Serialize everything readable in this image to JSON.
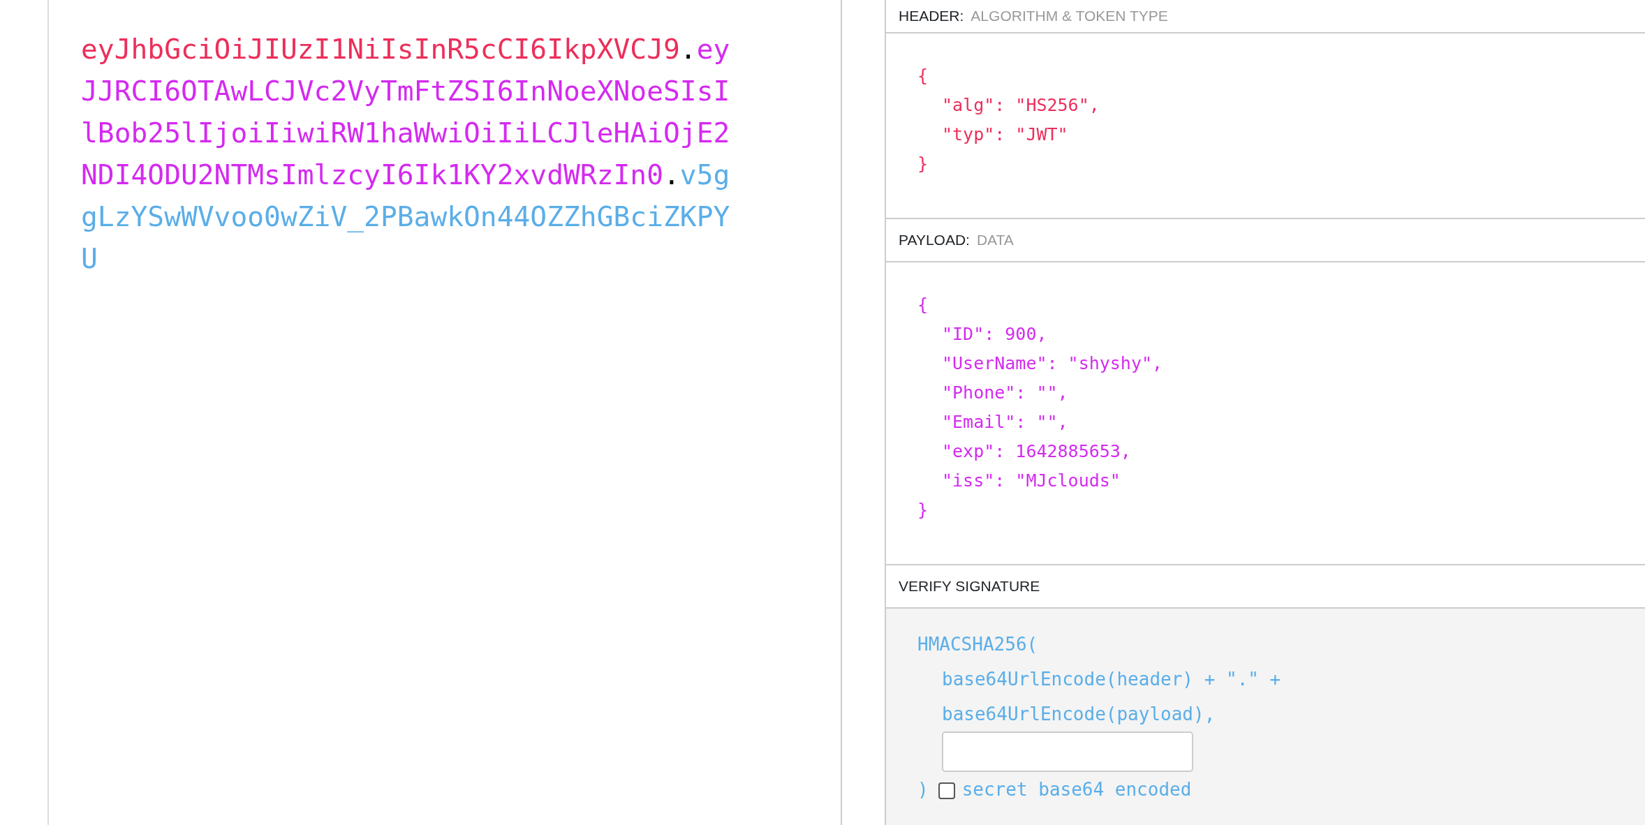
{
  "token": {
    "parts": [
      {
        "kind": "header",
        "text": "eyJhbGciOiJIUzI1NiIsInR5cCI6IkpXVCJ9"
      },
      {
        "kind": "dot",
        "text": "."
      },
      {
        "kind": "payload",
        "text": "eyJJRCI6OTAwLCJVc2VyTmFtZSI6InNoeXNoeSIsIlBob25lIjoiIiwiRW1haWwiOiIiLCJleHAiOjE2NDI4ODU2NTMsImlzcyI6Ik1KY2xvdWRzIn0"
      },
      {
        "kind": "dot",
        "text": "."
      },
      {
        "kind": "signature",
        "text": "v5ggLzYSwWVvoo0wZiV_2PBawkOn44OZZhGBciZKPYU"
      }
    ]
  },
  "sections": [
    {
      "kind": "header",
      "title": "HEADER:",
      "subtitle": "ALGORITHM & TOKEN TYPE",
      "lines": [
        {
          "kind": "brace",
          "text": "{"
        },
        {
          "kind": "field",
          "text": "\"alg\": \"HS256\","
        },
        {
          "kind": "field",
          "text": "\"typ\": \"JWT\""
        },
        {
          "kind": "brace",
          "text": "}"
        }
      ]
    },
    {
      "kind": "payload",
      "title": "PAYLOAD:",
      "subtitle": "DATA",
      "lines": [
        {
          "kind": "brace",
          "text": "{"
        },
        {
          "kind": "field",
          "text": "\"ID\": 900,"
        },
        {
          "kind": "field",
          "text": "\"UserName\": \"shyshy\","
        },
        {
          "kind": "field",
          "text": "\"Phone\": \"\","
        },
        {
          "kind": "field",
          "text": "\"Email\": \"\","
        },
        {
          "kind": "field",
          "text": "\"exp\": 1642885653,"
        },
        {
          "kind": "field",
          "text": "\"iss\": \"MJclouds\""
        },
        {
          "kind": "brace",
          "text": "}"
        }
      ]
    },
    {
      "kind": "verify",
      "title": "VERIFY SIGNATURE",
      "lines": [
        {
          "kind": "brace",
          "text": "HMACSHA256("
        },
        {
          "kind": "field",
          "text": "base64UrlEncode(header) + \".\" +"
        },
        {
          "kind": "field",
          "text": "base64UrlEncode(payload),"
        },
        {
          "kind": "secret"
        },
        {
          "kind": "close",
          "text": ")",
          "checkbox_label": "secret base64 encoded",
          "checked": false
        }
      ]
    }
  ]
}
